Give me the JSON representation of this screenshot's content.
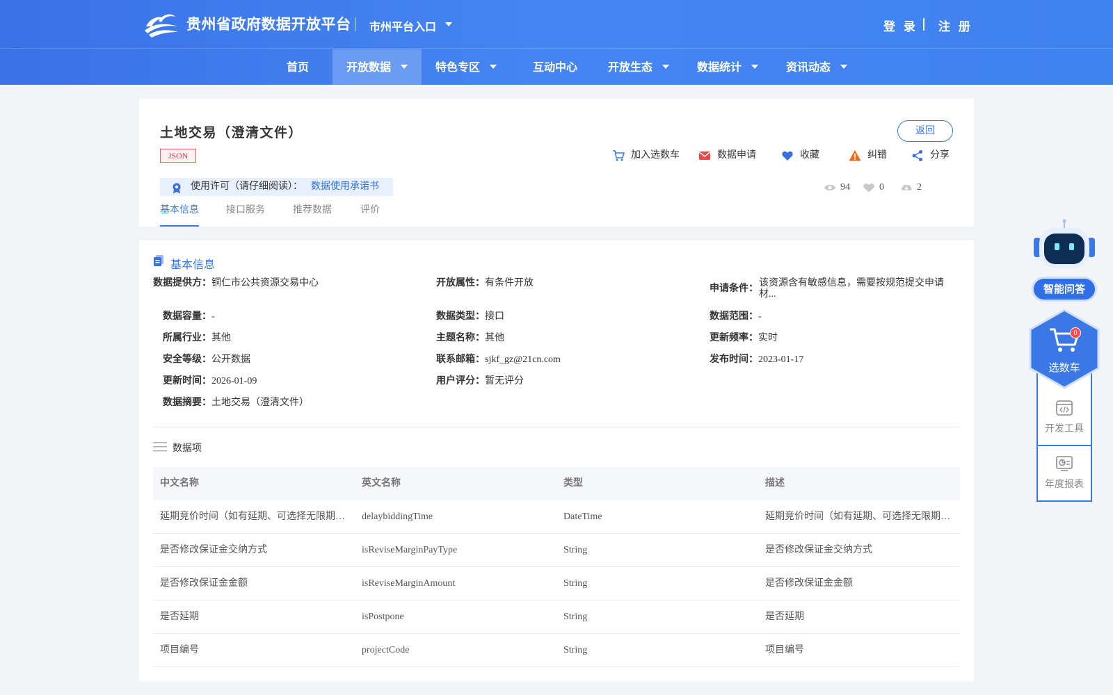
{
  "header": {
    "brand": "贵州省政府数据开放平台",
    "city_entry": "市州平台入口",
    "login": "登 录",
    "register": "注 册"
  },
  "nav": {
    "items": [
      {
        "label": "首页",
        "dropdown": false,
        "active": false
      },
      {
        "label": "开放数据",
        "dropdown": true,
        "active": true
      },
      {
        "label": "特色专区",
        "dropdown": true,
        "active": false
      },
      {
        "label": "互动中心",
        "dropdown": false,
        "active": false
      },
      {
        "label": "开放生态",
        "dropdown": true,
        "active": false
      },
      {
        "label": "数据统计",
        "dropdown": true,
        "active": false
      },
      {
        "label": "资讯动态",
        "dropdown": true,
        "active": false
      }
    ]
  },
  "dataset": {
    "title": "土地交易（澄清文件）",
    "format_tag": "JSON",
    "back": "返回",
    "actions": {
      "add_cart": "加入选数车",
      "apply": "数据申请",
      "favorite": "收藏",
      "report_error": "纠错",
      "share": "分享"
    },
    "license_text": "使用许可（请仔细阅读）：",
    "license_link": "数据使用承诺书",
    "stats": {
      "views": "94",
      "likes": "0",
      "downloads": "2"
    },
    "tabs": [
      "基本信息",
      "接口服务",
      "推荐数据",
      "评价"
    ]
  },
  "basic_info": {
    "section_title": "基本信息",
    "fields": {
      "provider": {
        "key": "数据提供方：",
        "value": "铜仁市公共资源交易中心"
      },
      "open_attr": {
        "key": "开放属性：",
        "value": "有条件开放"
      },
      "apply_cond": {
        "key": "申请条件：",
        "value": "该资源含有敏感信息，需要按规范提交申请材..."
      },
      "capacity": {
        "key": "数据容量：",
        "value": "-"
      },
      "data_type": {
        "key": "数据类型：",
        "value": "接口"
      },
      "data_range": {
        "key": "数据范围：",
        "value": "-"
      },
      "industry": {
        "key": "所属行业：",
        "value": "其他"
      },
      "theme": {
        "key": "主题名称：",
        "value": "其他"
      },
      "frequency": {
        "key": "更新频率：",
        "value": "实时"
      },
      "security": {
        "key": "安全等级：",
        "value": "公开数据"
      },
      "email": {
        "key": "联系邮箱：",
        "value": "sjkf_gz@21cn.com"
      },
      "publish_time": {
        "key": "发布时间：",
        "value": "2023-01-17"
      },
      "update_time": {
        "key": "更新时间：",
        "value": "2026-01-09"
      },
      "rating": {
        "key": "用户评分：",
        "value": "暂无评分"
      },
      "summary": {
        "key": "数据摘要：",
        "value": "土地交易（澄清文件）"
      }
    }
  },
  "data_items": {
    "title": "数据项",
    "columns": [
      "中文名称",
      "英文名称",
      "类型",
      "描述"
    ],
    "rows": [
      [
        "延期竞价时间（如有延期、可选择无限期延期）",
        "delaybiddingTime",
        "DateTime",
        "延期竞价时间（如有延期、可选择无限期延期）"
      ],
      [
        "是否修改保证金交纳方式",
        "isReviseMarginPayType",
        "String",
        "是否修改保证金交纳方式"
      ],
      [
        "是否修改保证金金额",
        "isReviseMarginAmount",
        "String",
        "是否修改保证金金额"
      ],
      [
        "是否延期",
        "isPostpone",
        "String",
        "是否延期"
      ],
      [
        "项目编号",
        "projectCode",
        "String",
        "项目编号"
      ]
    ]
  },
  "side": {
    "ask": "智能问答",
    "cart": "选数车",
    "cart_count": "0",
    "dev_tools": "开发工具",
    "annual_report": "年度报表"
  },
  "colors": {
    "primary": "#3a78e6",
    "danger": "#e04040",
    "warning": "#ff7a00"
  }
}
